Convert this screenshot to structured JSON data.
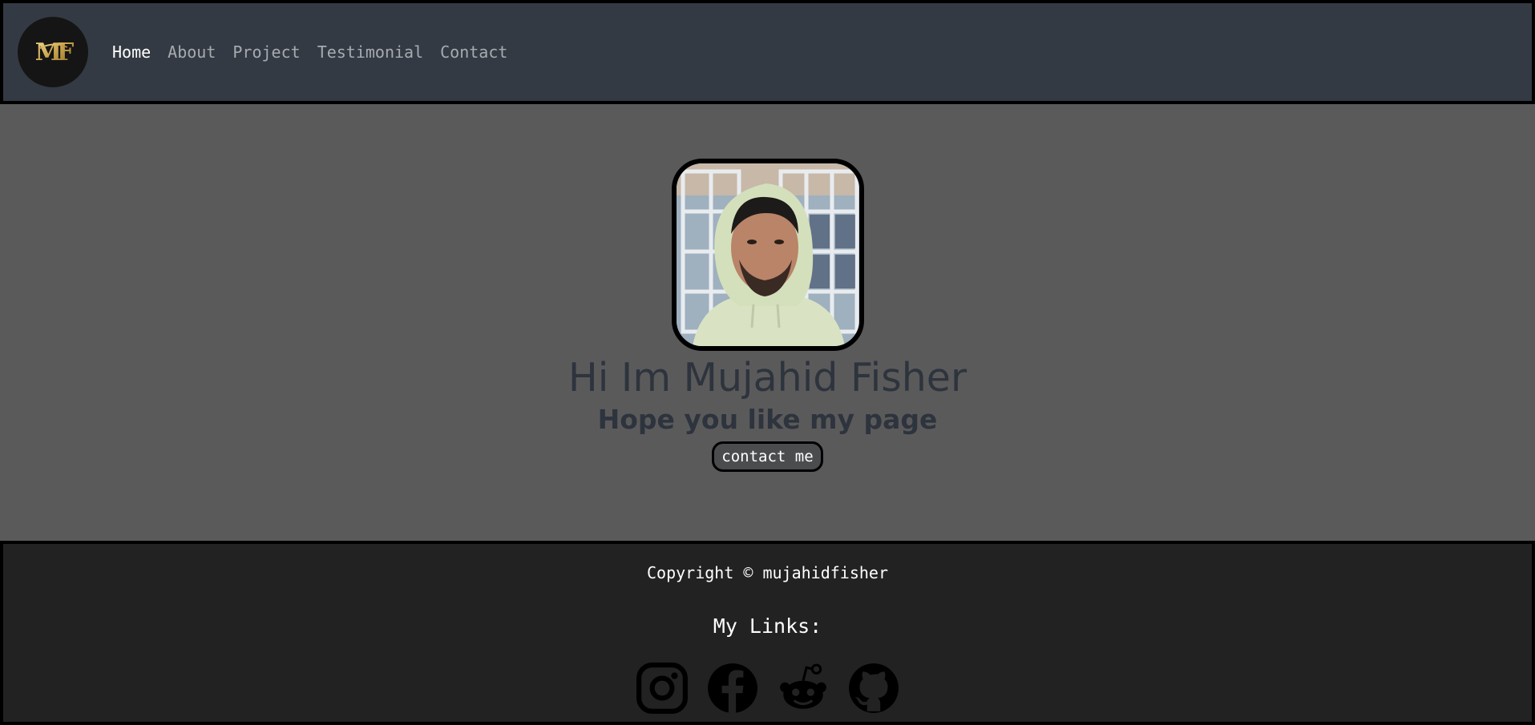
{
  "nav": {
    "logo_icon": "mf-monogram-logo-icon",
    "links": [
      "Home",
      "About",
      "Project",
      "Testimonial",
      "Contact"
    ],
    "active": "Home"
  },
  "hero": {
    "photo_icon": "profile-photo",
    "title": "Hi Im Mujahid Fisher",
    "subtitle": "Hope you like my page",
    "cta_label": "contact me"
  },
  "footer": {
    "copyright": "Copyright © mujahidfisher",
    "links_title": "My Links:",
    "social_icons": [
      "instagram-icon",
      "facebook-icon",
      "reddit-icon",
      "github-icon"
    ]
  },
  "colors": {
    "nav_bg": "#343a43",
    "hero_bg": "#5b5a5b",
    "footer_bg": "#222222",
    "text_dark": "#2e343d",
    "logo_gold": "#c9a24a"
  }
}
